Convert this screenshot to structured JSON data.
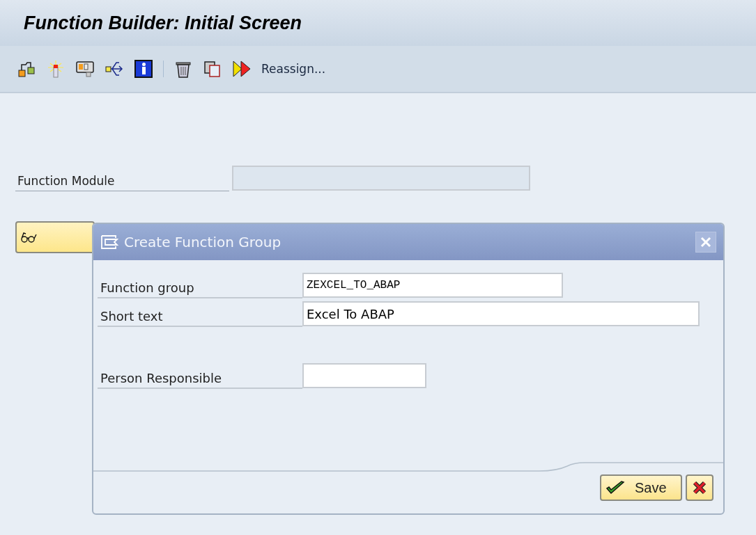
{
  "window": {
    "title": "Function Builder: Initial Screen"
  },
  "toolbar": {
    "label": "Reassign..."
  },
  "form": {
    "label": "Function Module"
  },
  "dialog": {
    "title": "Create Function Group",
    "groups": [
      [
        {
          "label": "Function group",
          "value": "ZEXCEL_TO_ABAP",
          "kind": "key"
        },
        {
          "label": "Short text",
          "value": "Excel To ABAP",
          "kind": "text"
        }
      ],
      [
        {
          "label": "Person Responsible",
          "kind": "user"
        }
      ]
    ],
    "buttons": [
      {
        "kind": "save",
        "label": "Save"
      },
      {
        "kind": "cancel"
      }
    ]
  }
}
